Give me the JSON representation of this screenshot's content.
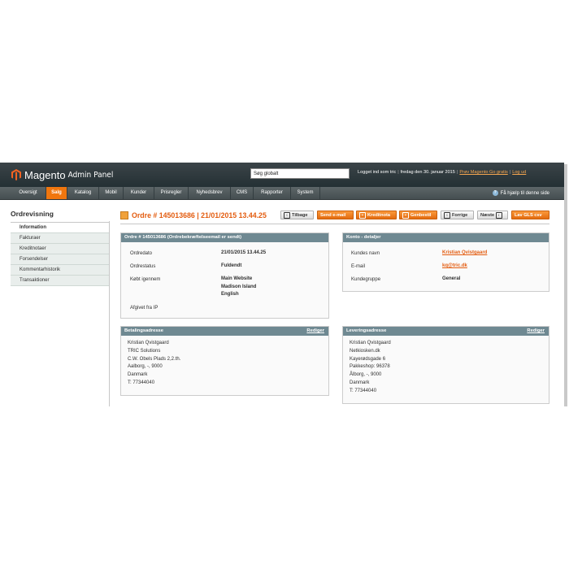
{
  "header": {
    "brand": "Magento",
    "subtitle": "Admin Panel",
    "search_placeholder": "Søg globalt",
    "logged_in": "Logget ind som tric",
    "date": "fredag den 30. januar 2015",
    "try_link": "Prøv Magento Go gratis",
    "logout_link": "Log ud"
  },
  "nav": {
    "items": [
      "Oversigt",
      "Salg",
      "Katalog",
      "Mobil",
      "Kunder",
      "Prisregler",
      "Nyhedsbrev",
      "CMS",
      "Rapporter",
      "System"
    ],
    "active": "Salg",
    "help": "Få hjælp til denne side"
  },
  "sidebar": {
    "title": "Ordrevisning",
    "tabs": [
      "Information",
      "Fakturaer",
      "Kreditnotaer",
      "Forsendelser",
      "Kommentarhistorik",
      "Transaktioner"
    ]
  },
  "page": {
    "title": "Ordre # 145013686 | 21/01/2015 13.44.25"
  },
  "buttons": {
    "back": "Tilbage",
    "send_email": "Send e-mail",
    "creditnote": "Kreditnota",
    "reorder": "Genbestil",
    "previous": "Forrige",
    "next": "Næste",
    "gls": "Lav GLS csv"
  },
  "order_box": {
    "title": "Ordre # 145013686 (Ordrebekræftelseemail er sendt)",
    "labels": [
      "Ordredato",
      "Ordrestatus",
      "Købt igennem",
      "Afgivet fra IP"
    ],
    "date": "21/01/2015 13.44.25",
    "status": "Fuldendt",
    "purchased_from": [
      "Main Website",
      "Madison Island",
      "English"
    ]
  },
  "account_box": {
    "title": "Konto - detaljer",
    "labels": [
      "Kundes navn",
      "E-mail",
      "Kundegruppe"
    ],
    "name": "Kristian Qvistgaard",
    "email": "kq@tric.dk",
    "group": "General"
  },
  "billing_box": {
    "title": "Betalingsadresse",
    "edit": "Rediger",
    "lines": [
      "Kristian Qvistgaard",
      "TRIC Solutions",
      "C.W. Obels Plads 2,2.th.",
      "Aalborg, -, 9000",
      "Danmark",
      "T: 77344040"
    ]
  },
  "shipping_box": {
    "title": "Leveringsadresse",
    "edit": "Rediger",
    "lines": [
      "Kristian Qvistgaard",
      "Netkiosken.dk",
      "Kayerødsgade 6",
      "Pakkeshop: 96378",
      "Ålborg, -, 9000",
      "Danmark",
      "T: 77344040"
    ]
  },
  "colors": {
    "accent": "#e35c0f",
    "header_bg": "#2e383b",
    "box_head": "#6f8992"
  }
}
